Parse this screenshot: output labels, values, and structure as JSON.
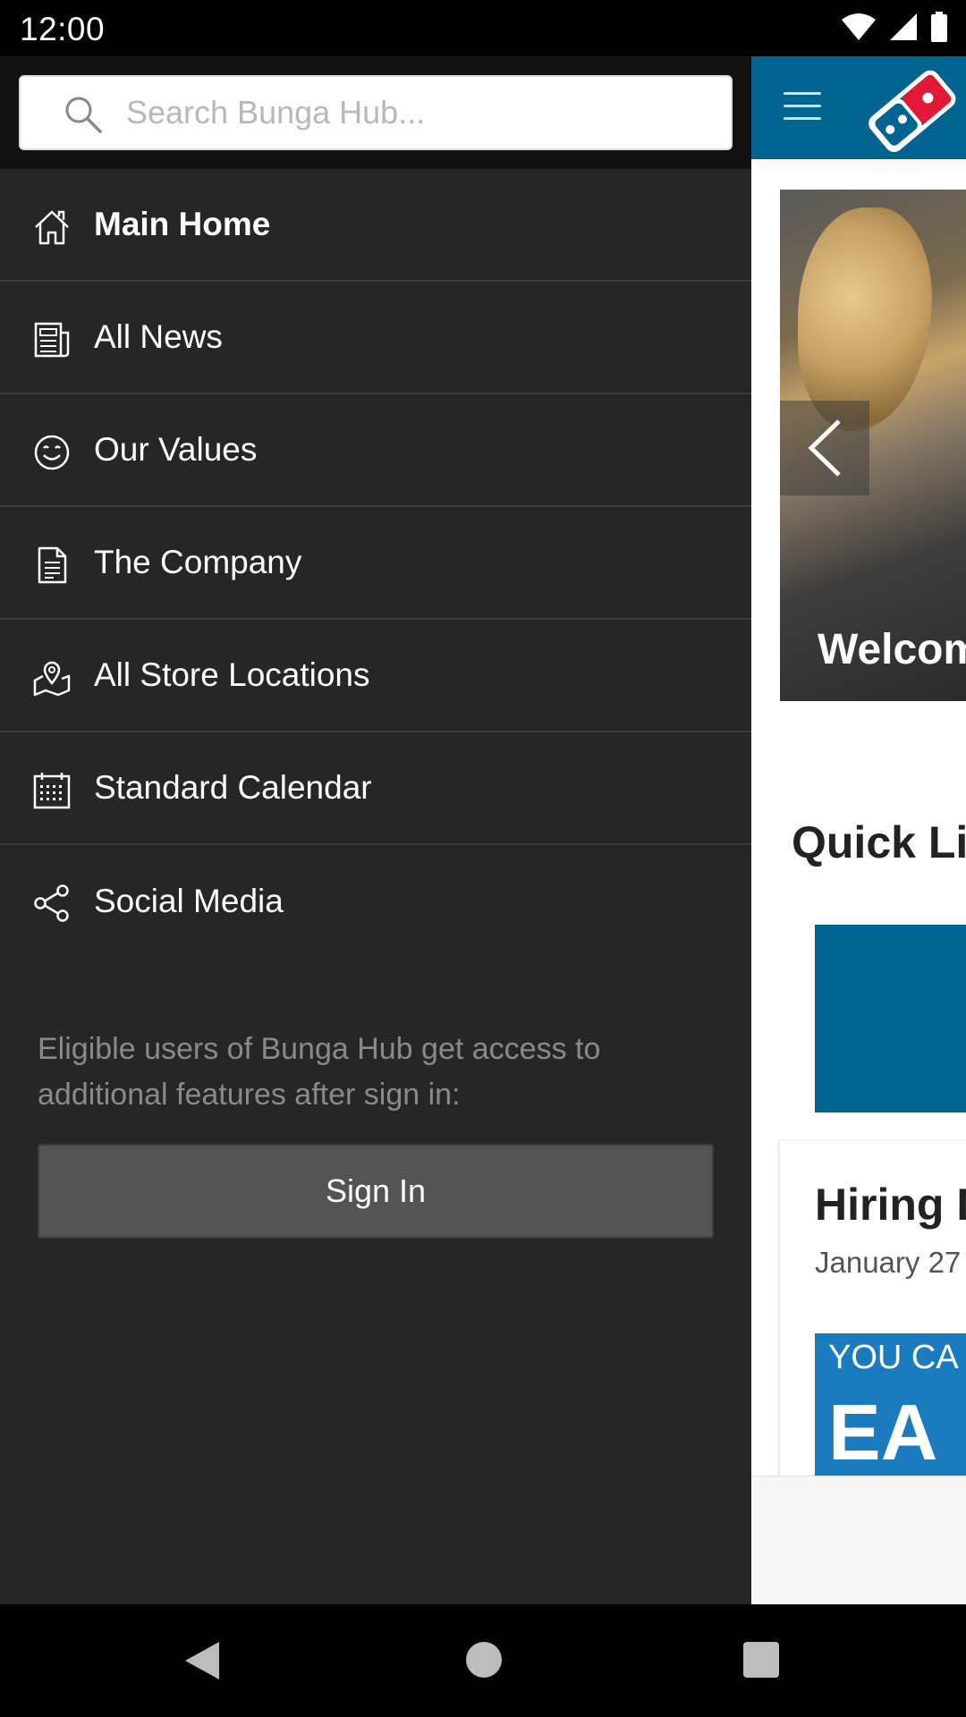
{
  "status_bar": {
    "time": "12:00"
  },
  "search": {
    "placeholder": "Search Bunga Hub..."
  },
  "menu": {
    "items": [
      {
        "label": "Main Home",
        "icon": "home-icon"
      },
      {
        "label": "All News",
        "icon": "newspaper-icon"
      },
      {
        "label": "Our Values",
        "icon": "smiley-icon"
      },
      {
        "label": "The Company",
        "icon": "document-icon"
      },
      {
        "label": "All Store Locations",
        "icon": "map-pin-icon"
      },
      {
        "label": "Standard Calendar",
        "icon": "calendar-icon"
      },
      {
        "label": "Social Media",
        "icon": "share-icon"
      }
    ]
  },
  "signin": {
    "text": "Eligible users of Bunga Hub get access to additional features after sign in:",
    "button_label": "Sign In"
  },
  "app": {
    "hero_title": "Welcom",
    "quick_links_title": "Quick Li",
    "card": {
      "title": "Hiring D",
      "date": "January 27",
      "banner_small": "YOU CA",
      "banner_big": "EA"
    }
  },
  "colors": {
    "brand": "#006491",
    "drawer": "#262626",
    "accent_red": "#e31837"
  }
}
